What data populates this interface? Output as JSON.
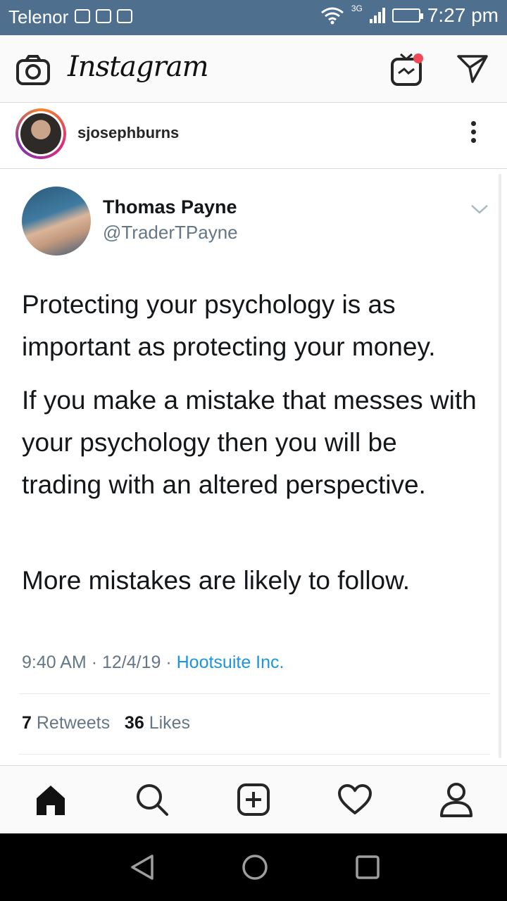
{
  "status_bar": {
    "carrier": "Telenor",
    "network": "3G",
    "time": "7:27 pm"
  },
  "header": {
    "logo": "Instagram",
    "icons": [
      "camera-icon",
      "igtv-icon",
      "direct-message-icon"
    ]
  },
  "post": {
    "username": "sjosephburns",
    "tweet": {
      "name": "Thomas Payne",
      "handle": "@TraderTPayne",
      "paragraph_1": "Protecting your psychology is as important as protecting your money.",
      "paragraph_2": "If you make a mistake that messes with your psychology then you will be trading with an altered perspective.",
      "paragraph_3": "More mistakes are likely to follow.",
      "time": "9:40 AM",
      "date": "12/4/19",
      "source": "Hootsuite Inc.",
      "retweets_count": "7",
      "retweets_label": "Retweets",
      "likes_count": "36",
      "likes_label": "Likes"
    }
  },
  "bottom_nav": {
    "items": [
      "home-icon",
      "search-icon",
      "add-post-icon",
      "heart-icon",
      "profile-icon"
    ]
  },
  "colors": {
    "status_bar": "#4f6f8f",
    "link": "#1b95e0",
    "notification_dot": "#ed4956"
  }
}
